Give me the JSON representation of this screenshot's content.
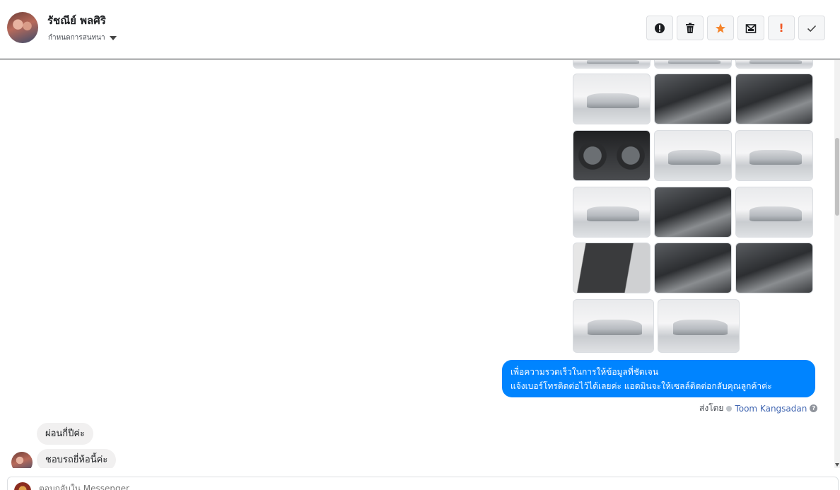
{
  "header": {
    "contact_name": "รัชณีย์ พลศิริ",
    "subtitle": "กำหนดการสนทนา"
  },
  "toolbar": [
    {
      "name": "alert-icon"
    },
    {
      "name": "trash-icon"
    },
    {
      "name": "star-icon",
      "color": "#f5842b"
    },
    {
      "name": "mark-unread-icon"
    },
    {
      "name": "priority-icon",
      "label": "!",
      "color": "#f05a28"
    },
    {
      "name": "check-icon"
    }
  ],
  "photos": [
    {
      "kind": "ext"
    },
    {
      "kind": "ext"
    },
    {
      "kind": "ext"
    },
    {
      "kind": "ext"
    },
    {
      "kind": "int"
    },
    {
      "kind": "int"
    },
    {
      "kind": "dash"
    },
    {
      "kind": "ext"
    },
    {
      "kind": "ext"
    },
    {
      "kind": "ext"
    },
    {
      "kind": "int"
    },
    {
      "kind": "ext"
    },
    {
      "kind": "door"
    },
    {
      "kind": "int"
    },
    {
      "kind": "int"
    },
    {
      "kind": "ext"
    },
    {
      "kind": "ext"
    }
  ],
  "outgoing": {
    "line1": "เพื่อความรวดเร็วในการให้ข้อมูลที่ชัดเจน",
    "line2": "แจ้งเบอร์โทรติดต่อไว้ได้เลยค่ะ แอดมินจะให้เซลล์ติดต่อกลับคุณลูกค้าค่ะ",
    "sent_by_label": "ส่งโดย",
    "sender": "Toom Kangsadan"
  },
  "incoming": [
    {
      "text": "ผ่อนกี่ปีค่ะ"
    },
    {
      "text": "ชอบรถยี่ห้อนี้ค่ะ"
    }
  ],
  "composer": {
    "placeholder": "ตอบกลับใน Messenger..."
  }
}
